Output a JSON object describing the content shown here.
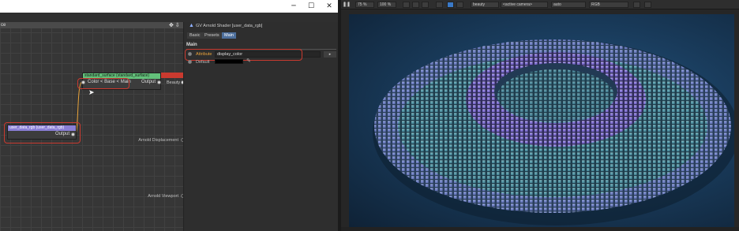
{
  "window": {
    "controls": {
      "minimize": "─",
      "maximize": "☐",
      "close": "✕"
    }
  },
  "node_editor": {
    "title": "ce",
    "header_icons": "✥ ⇩",
    "nodes": {
      "standard_surface": {
        "title": "standard_surface (standard_surface)",
        "input_label": "Color < Base < Main",
        "output_label": "Output",
        "beauty_label": "Beauty"
      },
      "user_data_rgb": {
        "title": "user_data_rgb (user_data_rgb)",
        "output_label": "Output"
      }
    },
    "side_ports": {
      "displacement": "Arnold Displacement",
      "viewport": "Arnold Viewport"
    }
  },
  "attributes": {
    "shader_title": "GV Arnold Shader [user_data_rgb]",
    "tabs": [
      "Basic",
      "Presets",
      "Main"
    ],
    "active_tab": "Main",
    "section": "Main",
    "attribute_label": "Attribute",
    "attribute_value": "display_color",
    "attribute_button": "▸",
    "default_label": "Default"
  },
  "viewer": {
    "toolbar": {
      "zoom": "75 %",
      "zoom2": "100 %",
      "aov": "beauty",
      "camera": "<active camera>",
      "mode": "auto",
      "color_space": "RGB",
      "pause_icon": "❚❚"
    }
  },
  "colors": {
    "node_green": "#63c07a",
    "node_purple": "#8a7fd6",
    "highlight_red": "#c93a2f",
    "tab_active": "#4d6f9c"
  }
}
